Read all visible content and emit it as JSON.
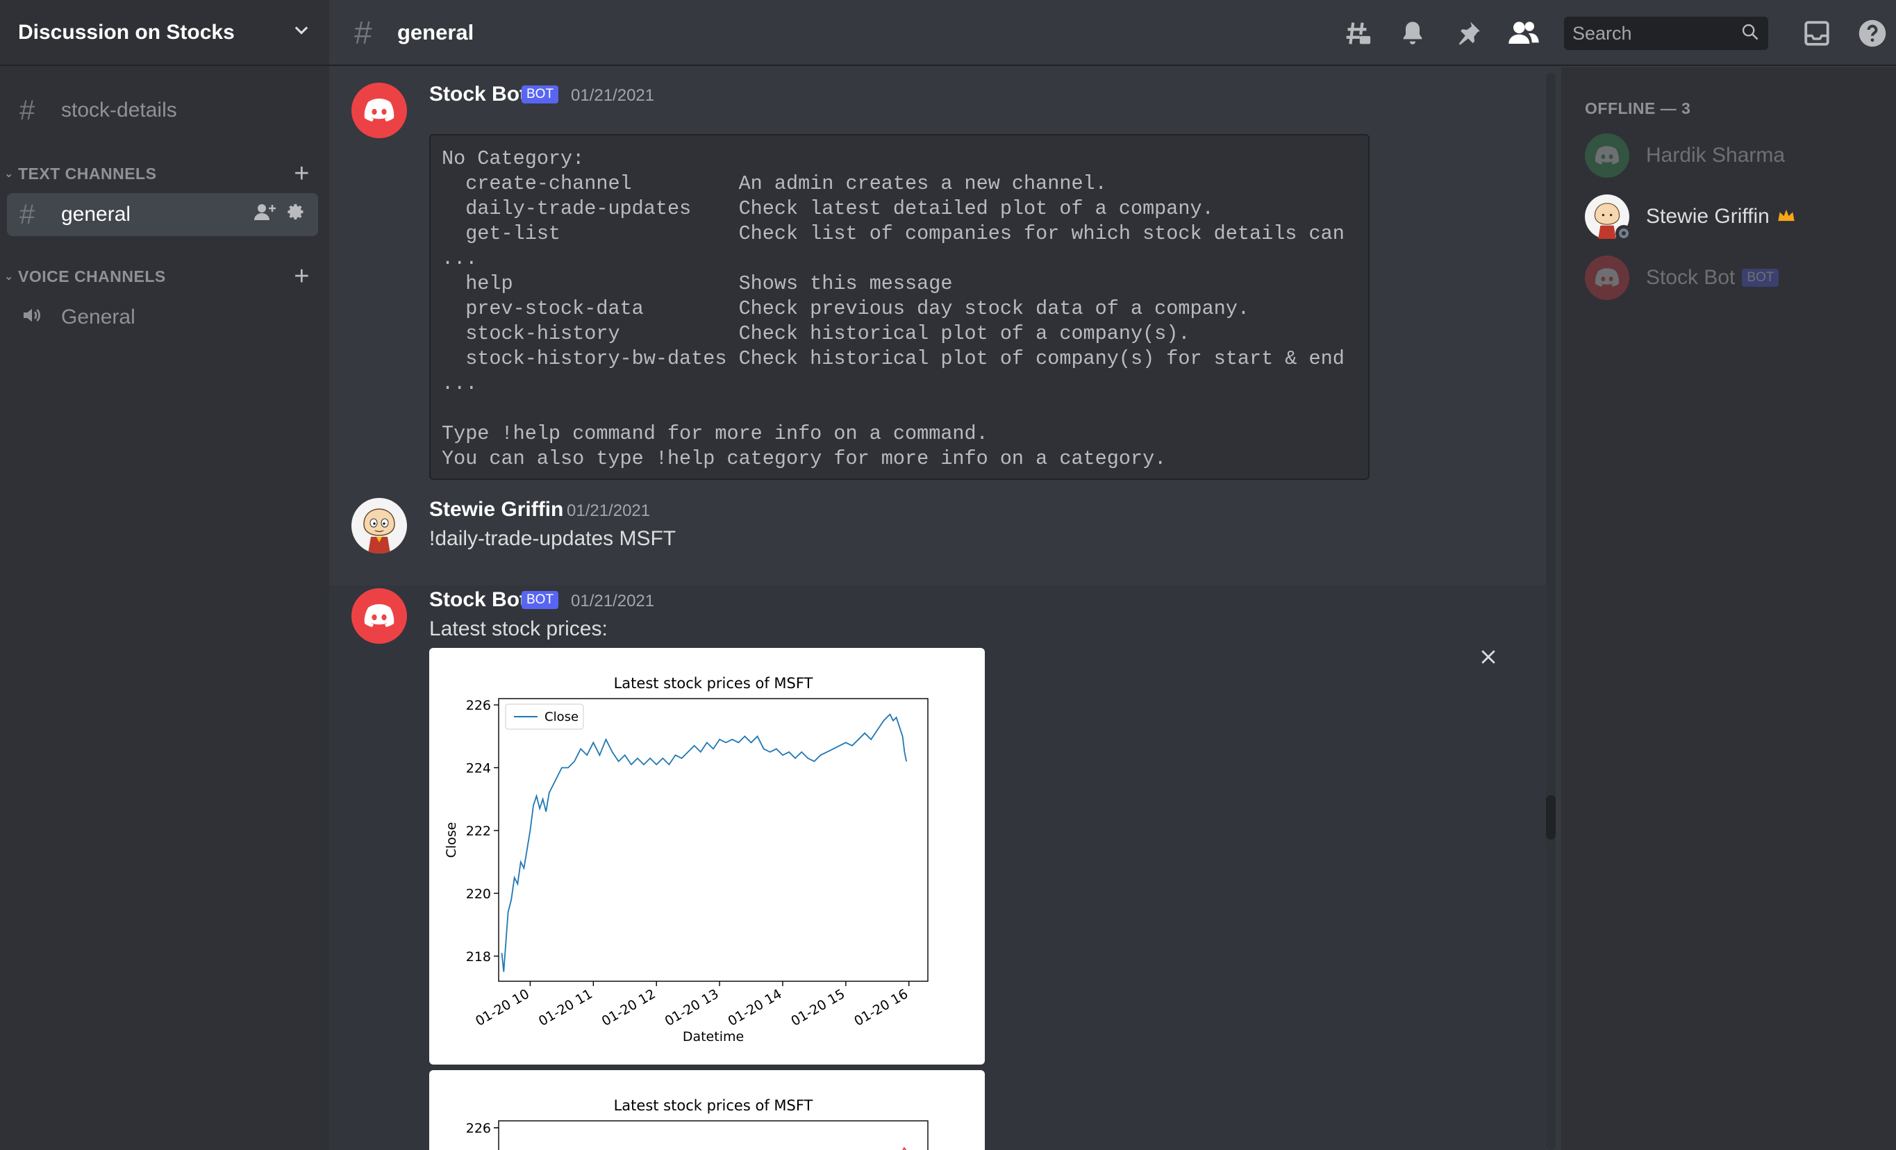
{
  "sidebar": {
    "server_name": "Discussion on Stocks",
    "pinned_channel": "stock-details",
    "text_category": "TEXT CHANNELS",
    "active_channel": "general",
    "voice_category": "VOICE CHANNELS",
    "voice_channel": "General"
  },
  "topbar": {
    "channel": "general",
    "search_placeholder": "Search",
    "icons": [
      "threads-icon",
      "bell-icon",
      "pin-icon",
      "members-icon",
      "inbox-icon",
      "help-icon"
    ]
  },
  "messages": [
    {
      "author": "Stock Bot",
      "badge": "BOT",
      "timestamp": "01/21/2021",
      "code_lines": [
        "No Category:",
        "  create-channel         An admin creates a new channel.",
        "  daily-trade-updates    Check latest detailed plot of a company.",
        "  get-list               Check list of companies for which stock details can",
        "...",
        "  help                   Shows this message",
        "  prev-stock-data        Check previous day stock data of a company.",
        "  stock-history          Check historical plot of a company(s).",
        "  stock-history-bw-dates Check historical plot of company(s) for start & end",
        "...",
        "",
        "Type !help command for more info on a command.",
        "You can also type !help category for more info on a category."
      ]
    },
    {
      "author": "Stewie Griffin",
      "timestamp": "01/21/2021",
      "content": "!daily-trade-updates MSFT"
    },
    {
      "author": "Stock Bot",
      "badge": "BOT",
      "timestamp": "01/21/2021",
      "content": "Latest stock prices:"
    }
  ],
  "members": {
    "header": "OFFLINE — 3",
    "list": [
      {
        "name": "Hardik Sharma"
      },
      {
        "name": "Stewie Griffin"
      },
      {
        "name": "Stock Bot",
        "badge": "BOT"
      }
    ]
  },
  "colors": {
    "accent": "#5865f2",
    "discord_red": "#ed4245",
    "discord_green": "#3ba55d",
    "line": "#1f77b4",
    "crown": "#faa61a"
  },
  "chart_data": [
    {
      "type": "line",
      "title": "Latest stock prices of MSFT",
      "xlabel": "Datetime",
      "ylabel": "Close",
      "legend": "top-left",
      "series": [
        {
          "name": "Close"
        }
      ],
      "x_ticks": [
        "01-20 10",
        "01-20 11",
        "01-20 12",
        "01-20 13",
        "01-20 14",
        "01-20 15",
        "01-20 16"
      ],
      "y_ticks": [
        "218",
        "220",
        "222",
        "224",
        "226"
      ],
      "ylim": [
        217.2,
        226.2
      ],
      "points": [
        [
          9.55,
          218.1
        ],
        [
          9.58,
          217.5
        ],
        [
          9.62,
          218.6
        ],
        [
          9.65,
          219.4
        ],
        [
          9.7,
          219.8
        ],
        [
          9.75,
          220.5
        ],
        [
          9.8,
          220.3
        ],
        [
          9.85,
          221.0
        ],
        [
          9.9,
          220.8
        ],
        [
          9.95,
          221.4
        ],
        [
          10.0,
          222.0
        ],
        [
          10.05,
          222.8
        ],
        [
          10.1,
          223.1
        ],
        [
          10.15,
          222.7
        ],
        [
          10.2,
          223.0
        ],
        [
          10.25,
          222.6
        ],
        [
          10.3,
          223.2
        ],
        [
          10.4,
          223.6
        ],
        [
          10.5,
          224.0
        ],
        [
          10.6,
          224.0
        ],
        [
          10.7,
          224.2
        ],
        [
          10.8,
          224.6
        ],
        [
          10.9,
          224.4
        ],
        [
          11.0,
          224.8
        ],
        [
          11.1,
          224.4
        ],
        [
          11.2,
          224.9
        ],
        [
          11.3,
          224.5
        ],
        [
          11.4,
          224.2
        ],
        [
          11.5,
          224.4
        ],
        [
          11.6,
          224.1
        ],
        [
          11.7,
          224.3
        ],
        [
          11.8,
          224.1
        ],
        [
          11.9,
          224.3
        ],
        [
          12.0,
          224.1
        ],
        [
          12.1,
          224.3
        ],
        [
          12.2,
          224.1
        ],
        [
          12.3,
          224.4
        ],
        [
          12.4,
          224.3
        ],
        [
          12.5,
          224.5
        ],
        [
          12.6,
          224.7
        ],
        [
          12.7,
          224.5
        ],
        [
          12.8,
          224.8
        ],
        [
          12.9,
          224.6
        ],
        [
          13.0,
          224.9
        ],
        [
          13.1,
          224.8
        ],
        [
          13.2,
          224.9
        ],
        [
          13.3,
          224.8
        ],
        [
          13.4,
          225.0
        ],
        [
          13.5,
          224.8
        ],
        [
          13.6,
          225.0
        ],
        [
          13.7,
          224.6
        ],
        [
          13.8,
          224.5
        ],
        [
          13.9,
          224.6
        ],
        [
          14.0,
          224.4
        ],
        [
          14.1,
          224.5
        ],
        [
          14.2,
          224.3
        ],
        [
          14.3,
          224.5
        ],
        [
          14.4,
          224.3
        ],
        [
          14.5,
          224.2
        ],
        [
          14.6,
          224.4
        ],
        [
          14.7,
          224.5
        ],
        [
          14.8,
          224.6
        ],
        [
          14.9,
          224.7
        ],
        [
          15.0,
          224.8
        ],
        [
          15.1,
          224.7
        ],
        [
          15.2,
          224.9
        ],
        [
          15.3,
          225.1
        ],
        [
          15.4,
          224.9
        ],
        [
          15.5,
          225.2
        ],
        [
          15.6,
          225.5
        ],
        [
          15.7,
          225.7
        ],
        [
          15.75,
          225.5
        ],
        [
          15.8,
          225.6
        ],
        [
          15.85,
          225.3
        ],
        [
          15.9,
          225.0
        ],
        [
          15.93,
          224.5
        ],
        [
          15.96,
          224.2
        ]
      ],
      "xlim": [
        9.5,
        16.3
      ]
    },
    {
      "type": "line",
      "title": "Latest stock prices of MSFT",
      "y_ticks": [
        "226"
      ]
    }
  ]
}
